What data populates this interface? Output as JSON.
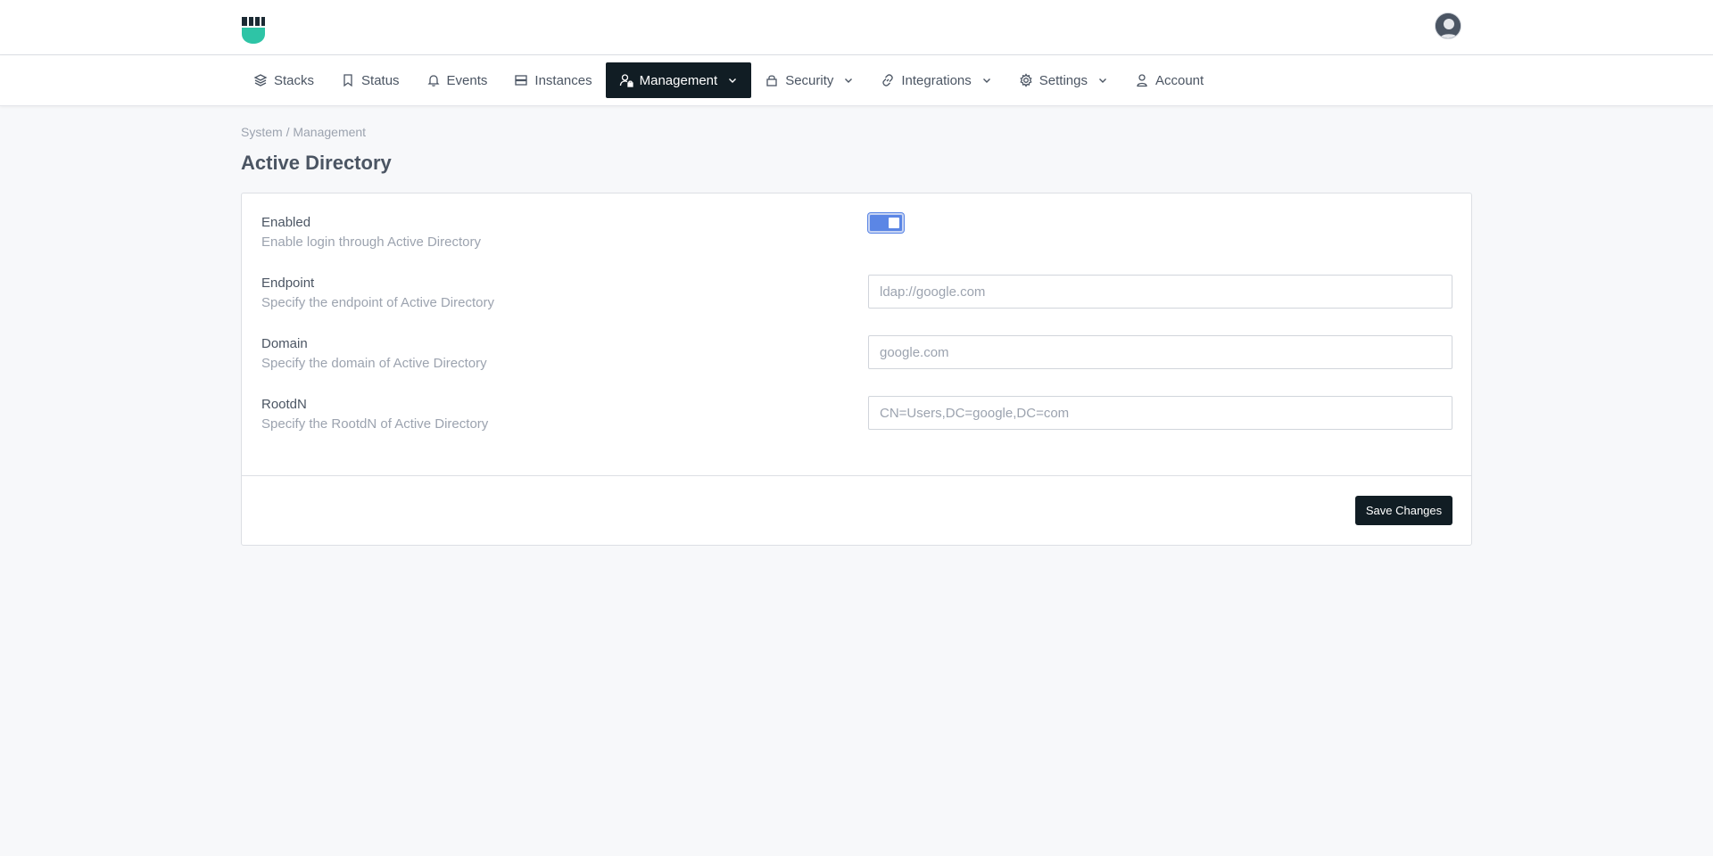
{
  "nav": {
    "items": [
      {
        "label": "Stacks",
        "icon": "layers-icon"
      },
      {
        "label": "Status",
        "icon": "bookmark-icon"
      },
      {
        "label": "Events",
        "icon": "bell-icon"
      },
      {
        "label": "Instances",
        "icon": "server-icon"
      },
      {
        "label": "Management",
        "icon": "user-lock-icon",
        "active": true,
        "dropdown": true
      },
      {
        "label": "Security",
        "icon": "lock-icon",
        "dropdown": true
      },
      {
        "label": "Integrations",
        "icon": "link-icon",
        "dropdown": true
      },
      {
        "label": "Settings",
        "icon": "gear-icon",
        "dropdown": true
      },
      {
        "label": "Account",
        "icon": "user-icon"
      }
    ]
  },
  "breadcrumb": "System / Management",
  "page_title": "Active Directory",
  "form": {
    "enabled": {
      "label": "Enabled",
      "help": "Enable login through Active Directory",
      "value": true
    },
    "endpoint": {
      "label": "Endpoint",
      "help": "Specify the endpoint of Active Directory",
      "placeholder": "ldap://google.com",
      "value": ""
    },
    "domain": {
      "label": "Domain",
      "help": "Specify the domain of Active Directory",
      "placeholder": "google.com",
      "value": ""
    },
    "rootdn": {
      "label": "RootdN",
      "help": "Specify the RootdN of Active Directory",
      "placeholder": "CN=Users,DC=google,DC=com",
      "value": ""
    },
    "save_label": "Save Changes"
  },
  "colors": {
    "nav_active_bg": "#111d24",
    "toggle_on": "#5b86e5",
    "logo_teal": "#2ec4a6",
    "logo_dark": "#1b2a33"
  }
}
